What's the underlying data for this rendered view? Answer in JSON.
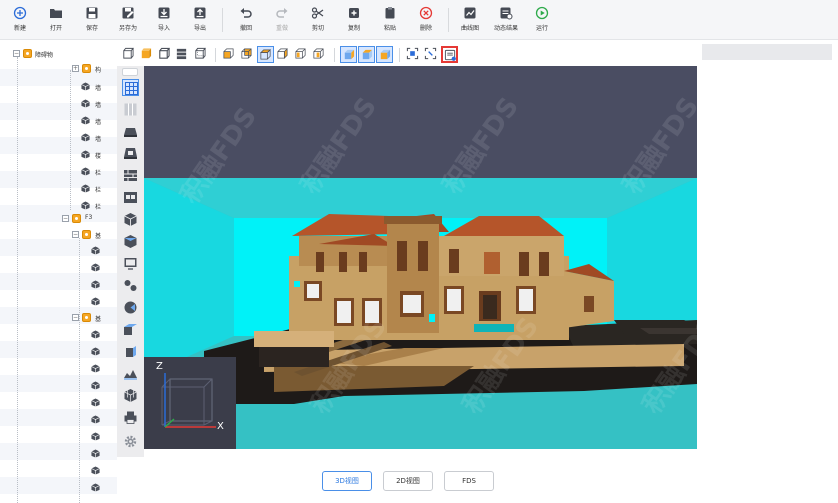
{
  "toolbar": {
    "buttons": [
      {
        "label": "新建",
        "icon": "plus-circle-icon"
      },
      {
        "label": "打开",
        "icon": "folder-open-icon"
      },
      {
        "label": "保存",
        "icon": "save-icon"
      },
      {
        "label": "另存为",
        "icon": "save-as-icon"
      },
      {
        "label": "导入",
        "icon": "import-icon"
      },
      {
        "label": "导出",
        "icon": "export-icon"
      },
      {
        "label": "撤回",
        "icon": "undo-icon"
      },
      {
        "label": "重做",
        "icon": "redo-icon",
        "disabled": true
      },
      {
        "label": "剪切",
        "icon": "scissors-icon"
      },
      {
        "label": "复制",
        "icon": "copy-icon"
      },
      {
        "label": "粘贴",
        "icon": "paste-icon"
      },
      {
        "label": "删除",
        "icon": "delete-icon"
      },
      {
        "label": "曲线图",
        "icon": "line-chart-icon"
      },
      {
        "label": "动态结果",
        "icon": "dynamic-result-icon"
      },
      {
        "label": "运行",
        "icon": "run-icon"
      }
    ]
  },
  "tree": {
    "root_label": "障碍物",
    "group_f3": "F3",
    "child_labels": [
      "构",
      "墙",
      "墙",
      "墙",
      "墙",
      "楼",
      "栏",
      "栏",
      "栏"
    ],
    "sub_group_labels": [
      "基",
      "基"
    ]
  },
  "bottom_tabs": {
    "view_3d": "3D视图",
    "view_2d": "2D视图",
    "fds": "FDS"
  },
  "viewport": {
    "axis_z": "Z",
    "axis_x": "X",
    "watermark": "积融FDS"
  },
  "colors": {
    "accent": "#4a8fe8",
    "highlight_border": "#e53935",
    "viewport_bg": "#4a4d62",
    "room_cyan": "#00e8f0",
    "floor_teal": "#35c1c4",
    "folder": "#f5a623"
  }
}
